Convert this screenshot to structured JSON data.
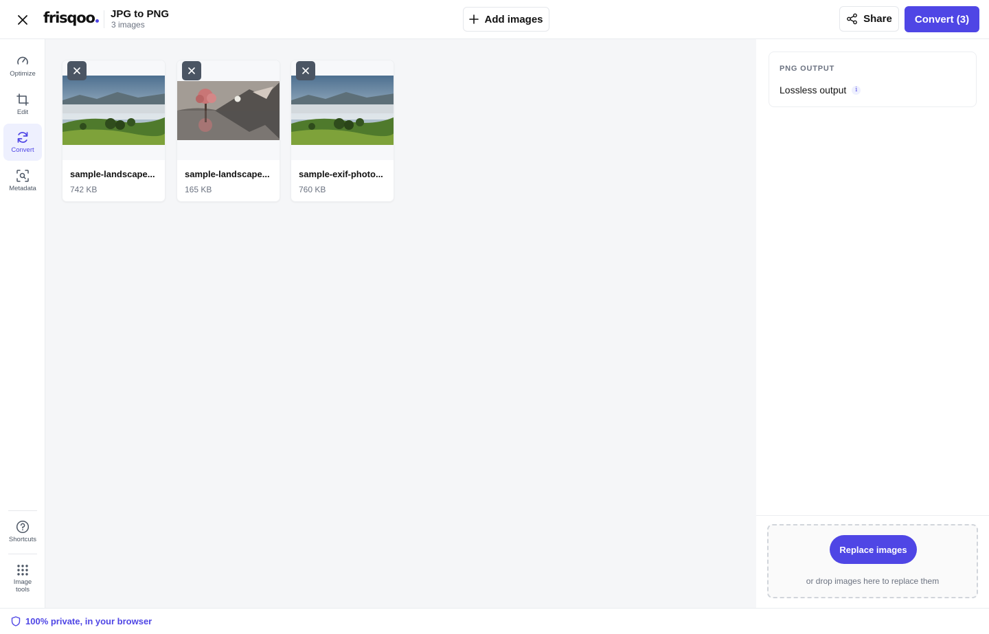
{
  "header": {
    "logo_text": "frisqoo",
    "title": "JPG to PNG",
    "subtitle": "3 images",
    "add_images_label": "Add images",
    "share_label": "Share",
    "convert_label": "Convert (3)"
  },
  "sidebar": {
    "items": [
      {
        "label": "Optimize",
        "icon": "gauge-icon"
      },
      {
        "label": "Edit",
        "icon": "crop-icon"
      },
      {
        "label": "Convert",
        "icon": "refresh-icon",
        "active": true
      },
      {
        "label": "Metadata",
        "icon": "scan-search-icon"
      }
    ],
    "bottom_items": [
      {
        "label": "Shortcuts",
        "icon": "help-circle-icon"
      },
      {
        "label": "Image tools",
        "icon": "grid-dots-icon"
      }
    ]
  },
  "images": [
    {
      "name": "sample-landscape...",
      "size": "742 KB",
      "thumb": "misty-valley"
    },
    {
      "name": "sample-landscape...",
      "size": "165 KB",
      "thumb": "tree-reflection"
    },
    {
      "name": "sample-exif-photo...",
      "size": "760 KB",
      "thumb": "misty-valley"
    }
  ],
  "output_panel": {
    "heading": "PNG OUTPUT",
    "value": "Lossless output",
    "info_glyph": "i"
  },
  "replace": {
    "button_label": "Replace images",
    "hint": "or drop images here to replace them"
  },
  "footer": {
    "text": "100% private, in your browser"
  },
  "colors": {
    "accent": "#4f46e5",
    "canvas_bg": "#f5f6f8"
  }
}
